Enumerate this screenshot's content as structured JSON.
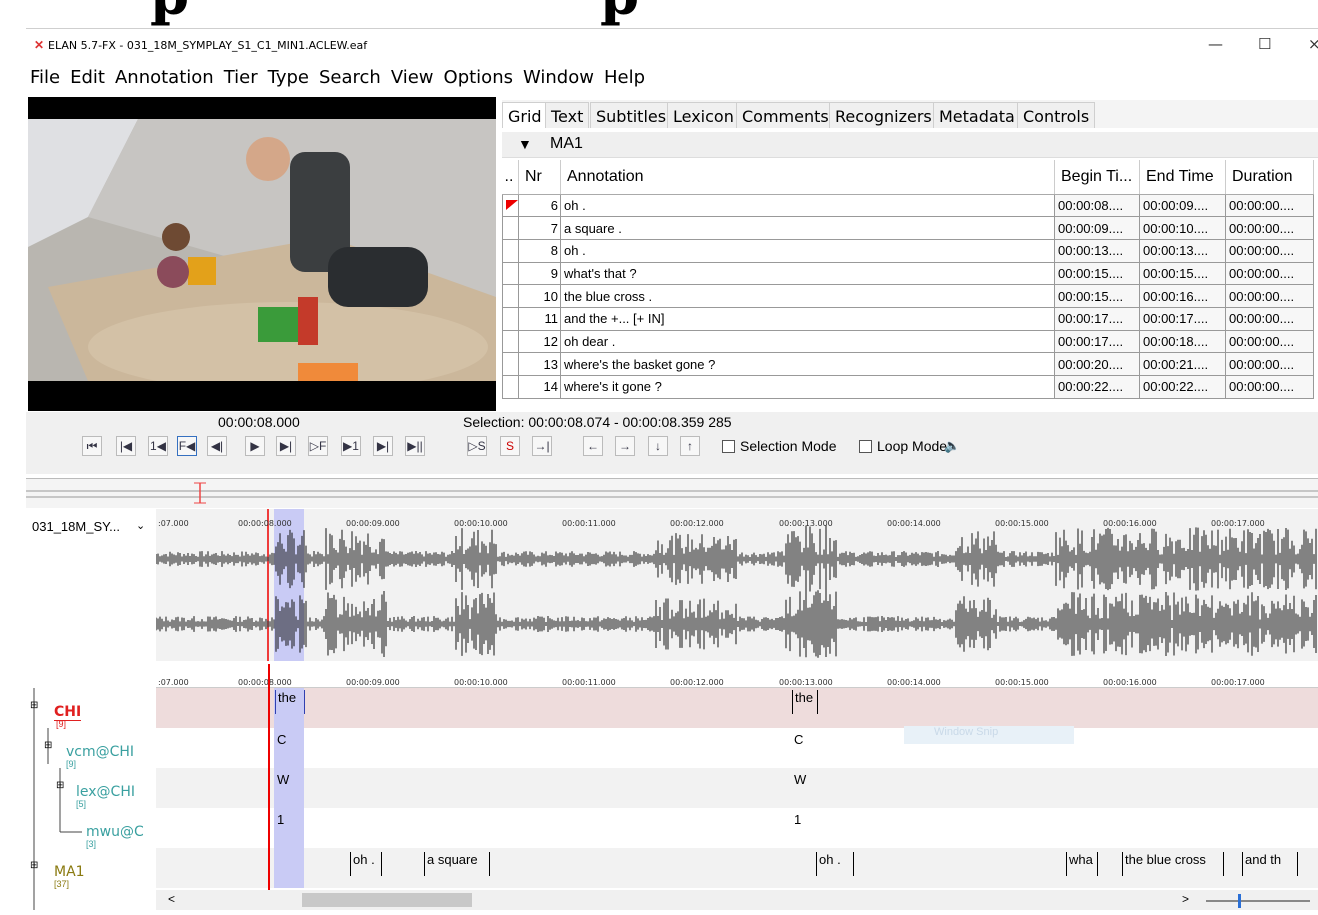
{
  "window": {
    "overflow_title_text": "p",
    "title": "ELAN 5.7-FX - 031_18M_SYMPLAY_S1_C1_MIN1.ACLEW.eaf",
    "minimize_glyph": "—",
    "maximize_glyph": "☐",
    "close_glyph": "×",
    "app_icon": "elan-icon"
  },
  "menu": [
    "File",
    "Edit",
    "Annotation",
    "Tier",
    "Type",
    "Search",
    "View",
    "Options",
    "Window",
    "Help"
  ],
  "tabs": [
    "Grid",
    "Text",
    "Subtitles",
    "Lexicon",
    "Comments",
    "Recognizers",
    "Metadata",
    "Controls"
  ],
  "grid": {
    "tier": "MA1",
    "dropdown_glyph": "▼",
    "columns": [
      "..",
      "Nr",
      "Annotation",
      "Begin Ti...",
      "End Time",
      "Duration"
    ],
    "rows": [
      {
        "nr": "6",
        "ann": "oh .",
        "begin": "00:00:08....",
        "end": "00:00:09....",
        "dur": "00:00:00...."
      },
      {
        "nr": "7",
        "ann": "a square .",
        "begin": "00:00:09....",
        "end": "00:00:10....",
        "dur": "00:00:00...."
      },
      {
        "nr": "8",
        "ann": "oh .",
        "begin": "00:00:13....",
        "end": "00:00:13....",
        "dur": "00:00:00...."
      },
      {
        "nr": "9",
        "ann": "what's that ?",
        "begin": "00:00:15....",
        "end": "00:00:15....",
        "dur": "00:00:00...."
      },
      {
        "nr": "10",
        "ann": "the blue cross .",
        "begin": "00:00:15....",
        "end": "00:00:16....",
        "dur": "00:00:00...."
      },
      {
        "nr": "11",
        "ann": "and the +... [+ IN]",
        "begin": "00:00:17....",
        "end": "00:00:17....",
        "dur": "00:00:00...."
      },
      {
        "nr": "12",
        "ann": "oh dear .",
        "begin": "00:00:17....",
        "end": "00:00:18....",
        "dur": "00:00:00...."
      },
      {
        "nr": "13",
        "ann": "where's the basket gone ?",
        "begin": "00:00:20....",
        "end": "00:00:21....",
        "dur": "00:00:00...."
      },
      {
        "nr": "14",
        "ann": "where's it gone ?",
        "begin": "00:00:22....",
        "end": "00:00:22....",
        "dur": "00:00:00...."
      }
    ]
  },
  "player": {
    "time": "00:00:08.000",
    "selection": "Selection: 00:00:08.074 - 00:00:08.359  285",
    "selection_mode": "Selection Mode",
    "loop_mode": "Loop Mode",
    "buttons": [
      "⏮",
      "|◀",
      "1◀",
      "F◀",
      "◀|",
      "▶",
      "▶|",
      "▷F",
      "▶1",
      "▶|",
      "▶||"
    ],
    "sel_buttons": [
      "▷S",
      "S",
      "→|"
    ],
    "nav_buttons": [
      "←",
      "→",
      "↓",
      "↑"
    ],
    "speaker_icon": "speaker-icon"
  },
  "waveform": {
    "media": "031_18M_SY...",
    "ticks": [
      ":07.000",
      "00:00:08.000",
      "00:00:09.000",
      "00:00:10.000",
      "00:00:11.000",
      "00:00:12.000",
      "00:00:13.000",
      "00:00:14.000",
      "00:00:15.000",
      "00:00:16.000",
      "00:00:17.000"
    ]
  },
  "tiers": [
    {
      "name": "CHI",
      "count": "[9]",
      "color": "#e02020"
    },
    {
      "name": "vcm@CHI",
      "count": "[9]",
      "color": "#3aa0a0"
    },
    {
      "name": "lex@CHI",
      "count": "[5]",
      "color": "#3aa0a0"
    },
    {
      "name": "mwu@C",
      "count": "[3]",
      "color": "#3aa0a0"
    },
    {
      "name": "MA1",
      "count": "[37]",
      "color": "#8a7a10"
    }
  ],
  "annotations": {
    "chi": [
      "the",
      "the"
    ],
    "vcm": [
      "C",
      "C"
    ],
    "lex": [
      "W",
      "W"
    ],
    "mwu": [
      "1",
      "1"
    ],
    "ma1": [
      "oh .",
      "a square",
      "oh .",
      "wha",
      "the blue cross",
      "and th"
    ]
  },
  "watermark": "Window Snip",
  "scroll_left": "<",
  "scroll_right": ">"
}
